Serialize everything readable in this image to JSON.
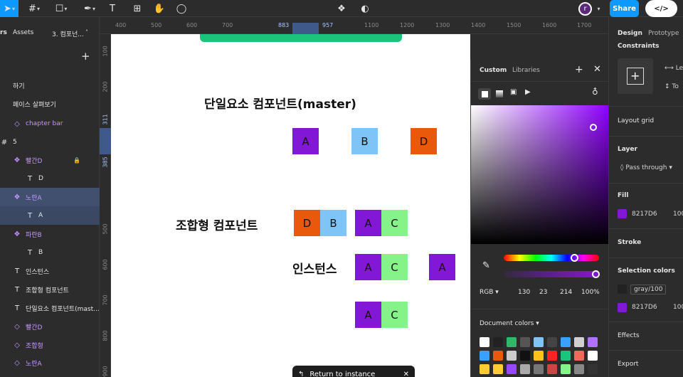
{
  "toolbar": {
    "share_label": "Share",
    "code_label": "</>",
    "avatar_initial": "r"
  },
  "left": {
    "tabs": {
      "layers": "rs",
      "assets": "Assets",
      "page": "3. 컴포넌..."
    },
    "add_label": "+",
    "layers": [
      {
        "icon": "",
        "label": "하기",
        "type": "text"
      },
      {
        "icon": "",
        "label": "페이스 살펴보기",
        "type": "text"
      },
      {
        "icon": "◇",
        "label": "chapter bar",
        "type": "comp"
      },
      {
        "icon": "#",
        "label": "5",
        "type": "frame"
      },
      {
        "icon": "❖",
        "label": "빨간D",
        "type": "comp"
      },
      {
        "icon": "T",
        "label": "D",
        "type": "text"
      },
      {
        "icon": "❖",
        "label": "노란A",
        "type": "comp"
      },
      {
        "icon": "T",
        "label": "A",
        "type": "text"
      },
      {
        "icon": "❖",
        "label": "파란B",
        "type": "comp"
      },
      {
        "icon": "T",
        "label": "B",
        "type": "text"
      },
      {
        "icon": "T",
        "label": "인스턴스",
        "type": "text"
      },
      {
        "icon": "T",
        "label": "조합형 컴포넌트",
        "type": "text"
      },
      {
        "icon": "T",
        "label": "단일요소 컴포넌트(mast...",
        "type": "text"
      },
      {
        "icon": "◇",
        "label": "빨간D",
        "type": "comp"
      },
      {
        "icon": "◇",
        "label": "조합형",
        "type": "comp"
      },
      {
        "icon": "◇",
        "label": "노란A",
        "type": "comp"
      }
    ]
  },
  "ruler_top": [
    "400",
    "500",
    "600",
    "700",
    "883",
    "957",
    "1100",
    "1200",
    "1300",
    "1400",
    "1500",
    "1600",
    "1700"
  ],
  "ruler_left": [
    "100",
    "200",
    "311",
    "385",
    "500",
    "600",
    "700",
    "800",
    "900",
    "1000"
  ],
  "canvas": {
    "title_single": "단일요소 컴포넌트(master)",
    "title_combo": "조합형 컴포넌트",
    "title_instance": "인스턴스",
    "master_boxes": [
      "A",
      "B",
      "D"
    ],
    "combo_boxes": [
      "D",
      "B",
      "A",
      "C"
    ],
    "instance_row1": [
      "A",
      "C",
      "A"
    ],
    "instance_row2": [
      "A",
      "C"
    ],
    "return_label": "Return to instance"
  },
  "picker": {
    "tab_custom": "Custom",
    "tab_libraries": "Libraries",
    "mode": "RGB",
    "r": "130",
    "g": "23",
    "b": "214",
    "alpha": "100%",
    "doc_colors_label": "Document colors",
    "doc_colors": [
      "#ffffff",
      "#222222",
      "#2fb86a",
      "#555555",
      "#7ec4f7",
      "#444444",
      "#3aa0ff",
      "#d0d0d0",
      "#b071ff",
      "#3aa0ff",
      "#e8590c",
      "#cccccc",
      "#111111",
      "#ffc21a",
      "#ff2424",
      "#1bc47d",
      "#f0695a",
      "#ffffff",
      "#ffcc33",
      "#ffcc33",
      "#9747ff",
      "#aaaaaa",
      "#777777",
      "#cc4444",
      "#85f38a",
      "#888888",
      "#333333"
    ]
  },
  "right": {
    "tab_design": "Design",
    "tab_prototype": "Prototype",
    "constraints": "Constraints",
    "constraint_h": "Le",
    "constraint_v": "To",
    "layout_grid": "Layout grid",
    "layer": "Layer",
    "blend": "Pass through",
    "fill": "Fill",
    "fill_hex": "8217D6",
    "fill_opacity": "100",
    "stroke": "Stroke",
    "selection_colors": "Selection colors",
    "sel1": "gray/100",
    "sel2": "8217D6",
    "sel2_opacity": "100",
    "effects": "Effects",
    "export": "Export"
  },
  "colors": {
    "accent": "#0d99ff",
    "purple": "#8217d6",
    "blue": "#7ec4f7",
    "orange": "#e8590c",
    "green": "#85f38a",
    "canvas_green": "#1bc47d"
  }
}
